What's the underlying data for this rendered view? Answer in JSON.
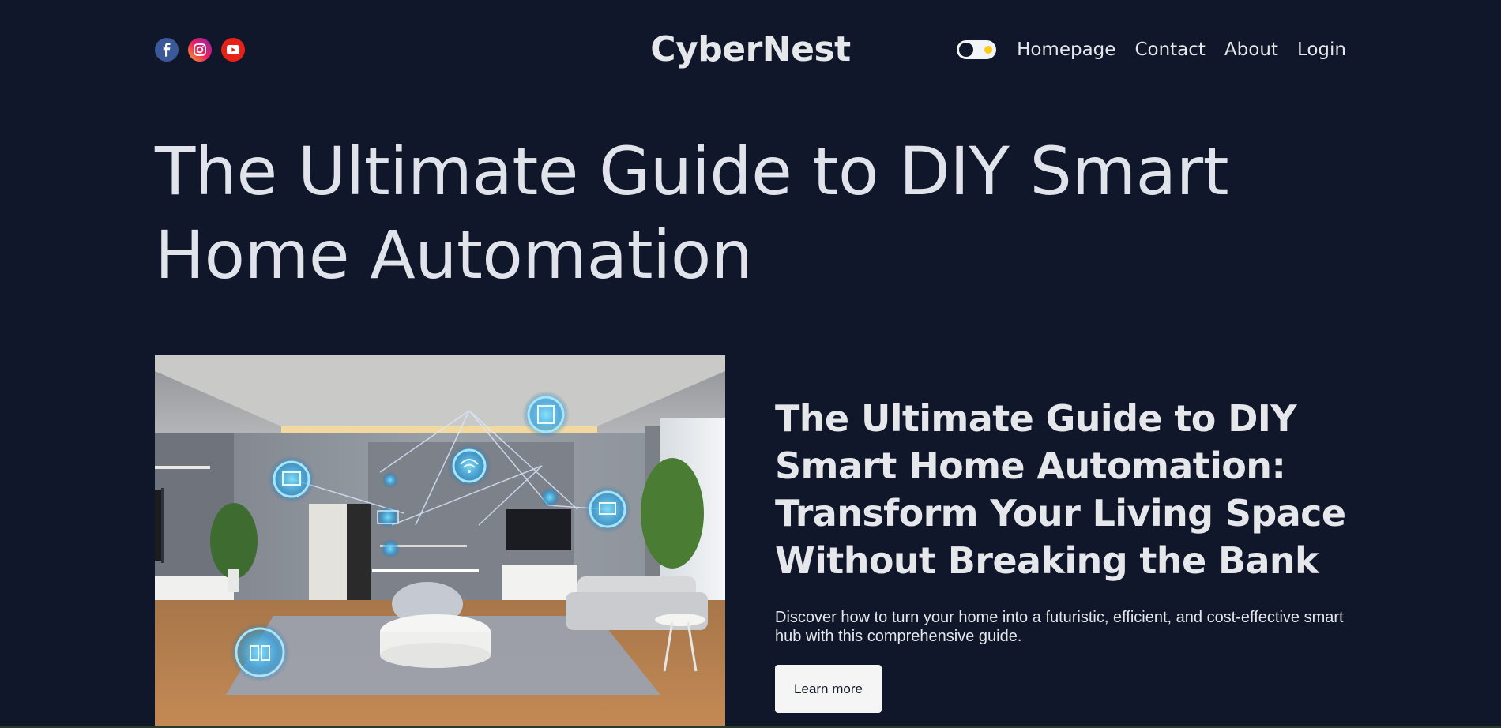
{
  "header": {
    "brand": "CyberNest",
    "social": [
      {
        "name": "facebook-icon"
      },
      {
        "name": "instagram-icon"
      },
      {
        "name": "youtube-icon"
      }
    ],
    "nav": [
      "Homepage",
      "Contact",
      "About",
      "Login"
    ]
  },
  "hero": {
    "title": "The Ultimate Guide to DIY Smart Home Automation"
  },
  "feature": {
    "title": "The Ultimate Guide to DIY Smart Home Automation: Transform Your Living Space Without Breaking the Bank",
    "description": "Discover how to turn your home into a futuristic, efficient, and cost-effective smart hub with this comprehensive guide.",
    "cta_label": "Learn more"
  },
  "colors": {
    "background": "#10172a",
    "text": "#e5e7eb",
    "button_bg": "#f5f5f5",
    "toggle_accent": "#facc15"
  }
}
